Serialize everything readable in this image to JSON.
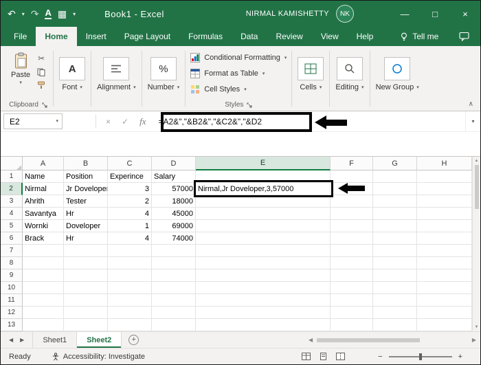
{
  "colors": {
    "title_green": "#217346",
    "accent_green": "#107c41",
    "ribbon_bg": "#f3f2f1",
    "annotation": "#050505"
  },
  "title_bar": {
    "title": "Book1 - Excel",
    "user_name": "NIRMAL KAMISHETTY",
    "avatar_initials": "NK"
  },
  "menu_bar": {
    "tabs": [
      {
        "label": "File",
        "active": false
      },
      {
        "label": "Home",
        "active": true
      },
      {
        "label": "Insert",
        "active": false
      },
      {
        "label": "Page Layout",
        "active": false
      },
      {
        "label": "Formulas",
        "active": false
      },
      {
        "label": "Data",
        "active": false
      },
      {
        "label": "Review",
        "active": false
      },
      {
        "label": "View",
        "active": false
      },
      {
        "label": "Help",
        "active": false
      }
    ],
    "tell_me_label": "Tell me"
  },
  "ribbon": {
    "paste_label": "Paste",
    "clipboard_group_label": "Clipboard",
    "styles_group_label": "Styles",
    "font_label": "Font",
    "alignment_label": "Alignment",
    "number_label": "Number",
    "cells_label": "Cells",
    "editing_label": "Editing",
    "new_group_label": "New Group",
    "styles_items": [
      "Conditional Formatting",
      "Format as Table",
      "Cell Styles"
    ]
  },
  "formula_bar": {
    "name_box_value": "E2",
    "formula": "=A2&\",\"&B2&\",\"&C2&\",\"&D2"
  },
  "sheet": {
    "col_headers": [
      "A",
      "B",
      "C",
      "D",
      "E",
      "F",
      "G",
      "H"
    ],
    "row_headers": [
      "1",
      "2",
      "3",
      "4",
      "5",
      "6",
      "7",
      "8",
      "9",
      "10",
      "11",
      "12",
      "13"
    ],
    "selected_col": "E",
    "selected_row": "2",
    "cells": [
      [
        "Name",
        "Position",
        "Experince",
        "Salary",
        "",
        "",
        "",
        ""
      ],
      [
        "Nirmal",
        "Jr Doveloper",
        "3",
        "57000",
        "Nirmal,Jr Doveloper,3,57000",
        "",
        "",
        ""
      ],
      [
        "Ahrith",
        "Tester",
        "2",
        "18000",
        "",
        "",
        "",
        ""
      ],
      [
        "Savantya",
        "Hr",
        "4",
        "45000",
        "",
        "",
        "",
        ""
      ],
      [
        "Wornki",
        "Doveloper",
        "1",
        "69000",
        "",
        "",
        "",
        ""
      ],
      [
        "Brack",
        "Hr",
        "4",
        "74000",
        "",
        "",
        "",
        ""
      ]
    ]
  },
  "sheet_tabs": {
    "tabs": [
      {
        "label": "Sheet1",
        "active": false
      },
      {
        "label": "Sheet2",
        "active": true
      }
    ]
  },
  "status_bar": {
    "ready_label": "Ready",
    "accessibility_label": "Accessibility: Investigate"
  },
  "icons": {
    "undo": "↶",
    "redo": "↷",
    "caret": "▾",
    "underline_a": "A",
    "table": "▦",
    "minimize": "—",
    "maximize": "□",
    "close": "×",
    "cut": "✂",
    "cancel": "×",
    "confirm": "✓",
    "fx": "fx",
    "font_a": "A",
    "percent": "%",
    "collapse_ribbon": "∧",
    "expand_formula_bar": "▾",
    "select_all": "◢",
    "left": "◀",
    "right": "▶",
    "up": "▲",
    "down": "▼",
    "add": "+",
    "zoom_out": "−",
    "zoom_in": "+"
  }
}
